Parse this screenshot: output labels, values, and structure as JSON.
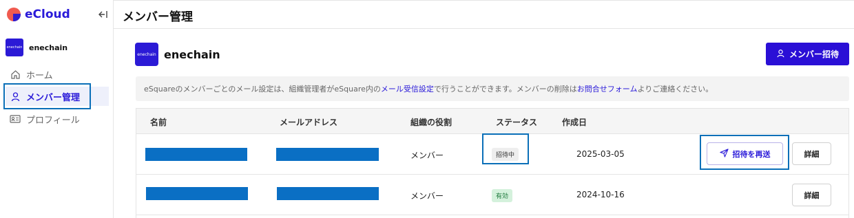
{
  "app": {
    "name": "eCloud"
  },
  "sidebar": {
    "org_logo_text": "enechain",
    "org_name": "enechain",
    "items": [
      {
        "label": "ホーム",
        "icon": "home-icon"
      },
      {
        "label": "メンバー管理",
        "icon": "user-icon"
      },
      {
        "label": "プロフィール",
        "icon": "id-card-icon"
      }
    ]
  },
  "header": {
    "title": "メンバー管理"
  },
  "main": {
    "org_logo_text": "enechain",
    "org_title": "enechain",
    "invite_button": "メンバー招待",
    "notice": {
      "part1": "eSquareのメンバーごとのメール設定は、組織管理者がeSquare内の",
      "link1": "メール受信設定",
      "part2": "で行うことができます。メンバーの削除は",
      "link2": "お問合せフォーム",
      "part3": "よりご連絡ください。"
    },
    "table": {
      "columns": [
        "名前",
        "メールアドレス",
        "組織の役割",
        "ステータス",
        "作成日"
      ],
      "rows": [
        {
          "role": "メンバー",
          "status": "招待中",
          "created": "2025-03-05",
          "resend": "招待を再送",
          "detail": "詳細"
        },
        {
          "role": "メンバー",
          "status": "有効",
          "created": "2024-10-16",
          "detail": "詳細"
        }
      ]
    }
  },
  "colors": {
    "brand": "#2a1ad9",
    "primary_button": "#2a0fd6",
    "highlight": "#0a6fb8",
    "redaction": "#0a6fc4"
  }
}
